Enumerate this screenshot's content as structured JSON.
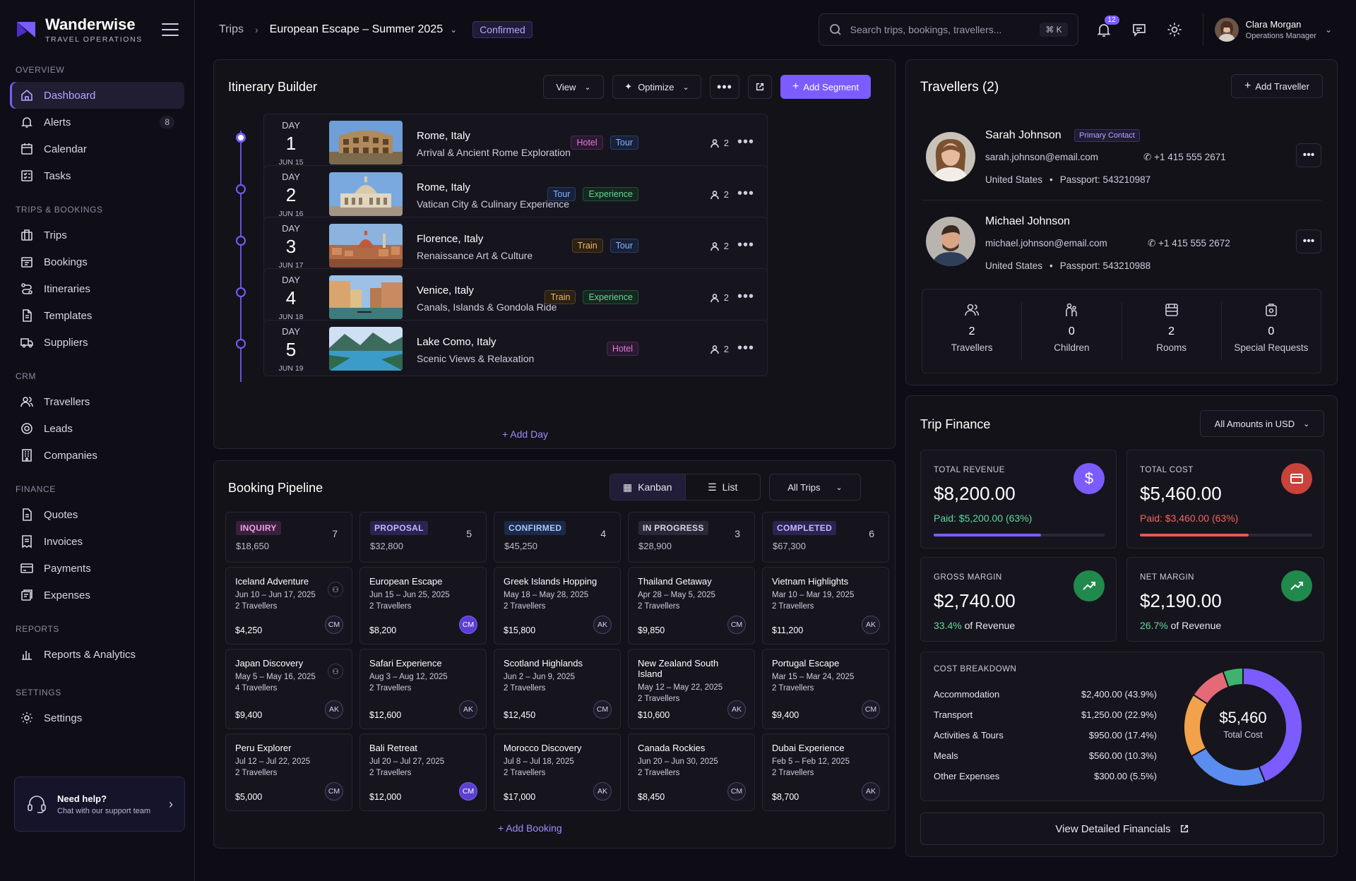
{
  "brand": {
    "name": "Wanderwise",
    "sub": "TRAVEL OPERATIONS"
  },
  "nav": {
    "overview_label": "OVERVIEW",
    "overview": [
      {
        "label": "Dashboard",
        "icon": "home-icon"
      },
      {
        "label": "Alerts",
        "badge": "8",
        "icon": "bell-icon"
      },
      {
        "label": "Calendar",
        "icon": "calendar-icon"
      },
      {
        "label": "Tasks",
        "icon": "tasks-icon"
      }
    ],
    "trips_label": "TRIPS & BOOKINGS",
    "trips": [
      {
        "label": "Trips"
      },
      {
        "label": "Bookings"
      },
      {
        "label": "Itineraries"
      },
      {
        "label": "Templates"
      },
      {
        "label": "Suppliers"
      }
    ],
    "crm_label": "CRM",
    "crm": [
      {
        "label": "Travellers"
      },
      {
        "label": "Leads"
      },
      {
        "label": "Companies"
      }
    ],
    "finance_label": "FINANCE",
    "finance": [
      {
        "label": "Quotes"
      },
      {
        "label": "Invoices"
      },
      {
        "label": "Payments"
      },
      {
        "label": "Expenses"
      }
    ],
    "reports_label": "REPORTS",
    "reports": [
      {
        "label": "Reports & Analytics"
      }
    ],
    "settings_label": "SETTINGS",
    "settings": [
      {
        "label": "Settings"
      }
    ]
  },
  "help": {
    "title": "Need help?",
    "sub": "Chat with our support team"
  },
  "topbar": {
    "crumb_root": "Trips",
    "crumb_current": "European Escape – Summer 2025",
    "status": "Confirmed",
    "search_placeholder": "Search trips, bookings, travellers...",
    "shortcut": "⌘ K",
    "notif_count": "12",
    "user_name": "Clara Morgan",
    "user_role": "Operations Manager"
  },
  "itinerary": {
    "title": "Itinerary Builder",
    "view_label": "View",
    "optimize_label": "Optimize",
    "add_segment": "Add Segment",
    "add_day": "Add Day",
    "day_label": "DAY",
    "days": [
      {
        "num": "1",
        "date": "JUN 15",
        "city": "Rome, Italy",
        "sub": "Arrival & Ancient Rome Exploration",
        "tags": [
          "Hotel",
          "Tour"
        ],
        "pax": "2"
      },
      {
        "num": "2",
        "date": "JUN 16",
        "city": "Rome, Italy",
        "sub": "Vatican City & Culinary Experience",
        "tags": [
          "Tour",
          "Experience"
        ],
        "pax": "2"
      },
      {
        "num": "3",
        "date": "JUN 17",
        "city": "Florence, Italy",
        "sub": "Renaissance Art & Culture",
        "tags": [
          "Train",
          "Tour"
        ],
        "pax": "2"
      },
      {
        "num": "4",
        "date": "JUN 18",
        "city": "Venice, Italy",
        "sub": "Canals, Islands & Gondola Ride",
        "tags": [
          "Train",
          "Experience"
        ],
        "pax": "2"
      },
      {
        "num": "5",
        "date": "JUN 19",
        "city": "Lake Como, Italy",
        "sub": "Scenic Views & Relaxation",
        "tags": [
          "Hotel"
        ],
        "pax": "2"
      }
    ]
  },
  "travellers": {
    "title": "Travellers (2)",
    "add_label": "Add Traveller",
    "primary_tag": "Primary Contact",
    "people": [
      {
        "name": "Sarah Johnson",
        "email": "sarah.johnson@email.com",
        "phone": "+1 415 555 2671",
        "country": "United States",
        "passport": "Passport: 543210987"
      },
      {
        "name": "Michael Johnson",
        "email": "michael.johnson@email.com",
        "phone": "+1 415 555 2672",
        "country": "United States",
        "passport": "Passport: 543210988"
      }
    ],
    "stats": [
      {
        "value": "2",
        "label": "Travellers"
      },
      {
        "value": "0",
        "label": "Children"
      },
      {
        "value": "2",
        "label": "Rooms"
      },
      {
        "value": "0",
        "label": "Special Requests"
      }
    ]
  },
  "pipeline": {
    "title": "Booking Pipeline",
    "kanban_label": "Kanban",
    "list_label": "List",
    "filter_label": "All Trips",
    "add_booking": "Add Booking",
    "columns": [
      {
        "name": "INQUIRY",
        "count": "7",
        "amount": "$18,650",
        "fg": "#e9a6e0",
        "bg": "#3a1f3e",
        "cards": [
          {
            "name": "Iceland Adventure",
            "date": "Jun 10 – Jun 17, 2025",
            "trav": "2 Travellers",
            "amt": "$4,250",
            "av": "CM"
          },
          {
            "name": "Japan Discovery",
            "date": "May 5 – May 16, 2025",
            "trav": "4 Travellers",
            "amt": "$9,400",
            "av": "AK"
          },
          {
            "name": "Peru Explorer",
            "date": "Jul 12 – Jul 22, 2025",
            "trav": "2 Travellers",
            "amt": "$5,000",
            "av": "CM"
          }
        ]
      },
      {
        "name": "PROPOSAL",
        "count": "5",
        "amount": "$32,800",
        "fg": "#c7b6ff",
        "bg": "#2c2350",
        "cards": [
          {
            "name": "European Escape",
            "date": "Jun 15 – Jun 25, 2025",
            "trav": "2 Travellers",
            "amt": "$8,200",
            "av": "CM"
          },
          {
            "name": "Safari Experience",
            "date": "Aug 3 – Aug 12, 2025",
            "trav": "2 Travellers",
            "amt": "$12,600",
            "av": "AK"
          },
          {
            "name": "Bali Retreat",
            "date": "Jul 20 – Jul 27, 2025",
            "trav": "2 Travellers",
            "amt": "$12,000",
            "av": "CM"
          }
        ]
      },
      {
        "name": "CONFIRMED",
        "count": "4",
        "amount": "$45,250",
        "fg": "#a9c6ff",
        "bg": "#1c2a4a",
        "cards": [
          {
            "name": "Greek Islands Hopping",
            "date": "May 18 – May 28, 2025",
            "trav": "2 Travellers",
            "amt": "$15,800",
            "av": "AK"
          },
          {
            "name": "Scotland Highlands",
            "date": "Jun 2 – Jun 9, 2025",
            "trav": "2 Travellers",
            "amt": "$12,450",
            "av": "CM"
          },
          {
            "name": "Morocco Discovery",
            "date": "Jul 8 – Jul 18, 2025",
            "trav": "2 Travellers",
            "amt": "$17,000",
            "av": "AK"
          }
        ]
      },
      {
        "name": "IN PROGRESS",
        "count": "3",
        "amount": "$28,900",
        "fg": "#d8d4e4",
        "bg": "#2a2838",
        "cards": [
          {
            "name": "Thailand Getaway",
            "date": "Apr 28 – May 5, 2025",
            "trav": "2 Travellers",
            "amt": "$9,850",
            "av": "CM"
          },
          {
            "name": "New Zealand South Island",
            "date": "May 12 – May 22, 2025",
            "trav": "2 Travellers",
            "amt": "$10,600",
            "av": "AK"
          },
          {
            "name": "Canada Rockies",
            "date": "Jun 20 – Jun 30, 2025",
            "trav": "2 Travellers",
            "amt": "$8,450",
            "av": "CM"
          }
        ]
      },
      {
        "name": "COMPLETED",
        "count": "6",
        "amount": "$67,300",
        "fg": "#c7b6ff",
        "bg": "#2c2350",
        "cards": [
          {
            "name": "Vietnam Highlights",
            "date": "Mar 10 – Mar 19, 2025",
            "trav": "2 Travellers",
            "amt": "$11,200",
            "av": "AK"
          },
          {
            "name": "Portugal Escape",
            "date": "Mar 15 – Mar 24, 2025",
            "trav": "2 Travellers",
            "amt": "$9,400",
            "av": "CM"
          },
          {
            "name": "Dubai Experience",
            "date": "Feb 5 – Feb 12, 2025",
            "trav": "2 Travellers",
            "amt": "$8,700",
            "av": "AK"
          }
        ]
      }
    ]
  },
  "finance": {
    "title": "Trip Finance",
    "currency_label": "All Amounts in USD",
    "revenue": {
      "label": "TOTAL REVENUE",
      "value": "$8,200.00",
      "paid": "Paid: $5,200.00 (63%)",
      "progress": 63
    },
    "cost": {
      "label": "TOTAL COST",
      "value": "$5,460.00",
      "paid": "Paid: $3,460.00 (63%)",
      "progress": 63
    },
    "gross": {
      "label": "GROSS MARGIN",
      "value": "$2,740.00",
      "pct": "33.4%",
      "suffix": "of Revenue"
    },
    "net": {
      "label": "NET MARGIN",
      "value": "$2,190.00",
      "pct": "26.7%",
      "suffix": "of Revenue"
    },
    "breakdown_label": "COST BREAKDOWN",
    "breakdown": [
      {
        "label": "Accommodation",
        "value": "$2,400.00 (43.9%)",
        "share": 43.9,
        "color": "#7c5cff"
      },
      {
        "label": "Transport",
        "value": "$1,250.00 (22.9%)",
        "share": 22.9,
        "color": "#5b8cf0"
      },
      {
        "label": "Activities & Tours",
        "value": "$950.00 (17.4%)",
        "share": 17.4,
        "color": "#f2a24a"
      },
      {
        "label": "Meals",
        "value": "$560.00 (10.3%)",
        "share": 10.3,
        "color": "#e56a78"
      },
      {
        "label": "Other Expenses",
        "value": "$300.00 (5.5%)",
        "share": 5.5,
        "color": "#3fb36e"
      }
    ],
    "donut_total": "$5,460",
    "donut_label": "Total Cost",
    "view_detailed": "View Detailed Financials"
  },
  "colors": {
    "accent": "#7c5cff",
    "revenue_bar": "#7c5cff",
    "cost_bar": "#e55a4e",
    "paid_green": "#5fd99a",
    "cost_red": "#f0665c"
  }
}
